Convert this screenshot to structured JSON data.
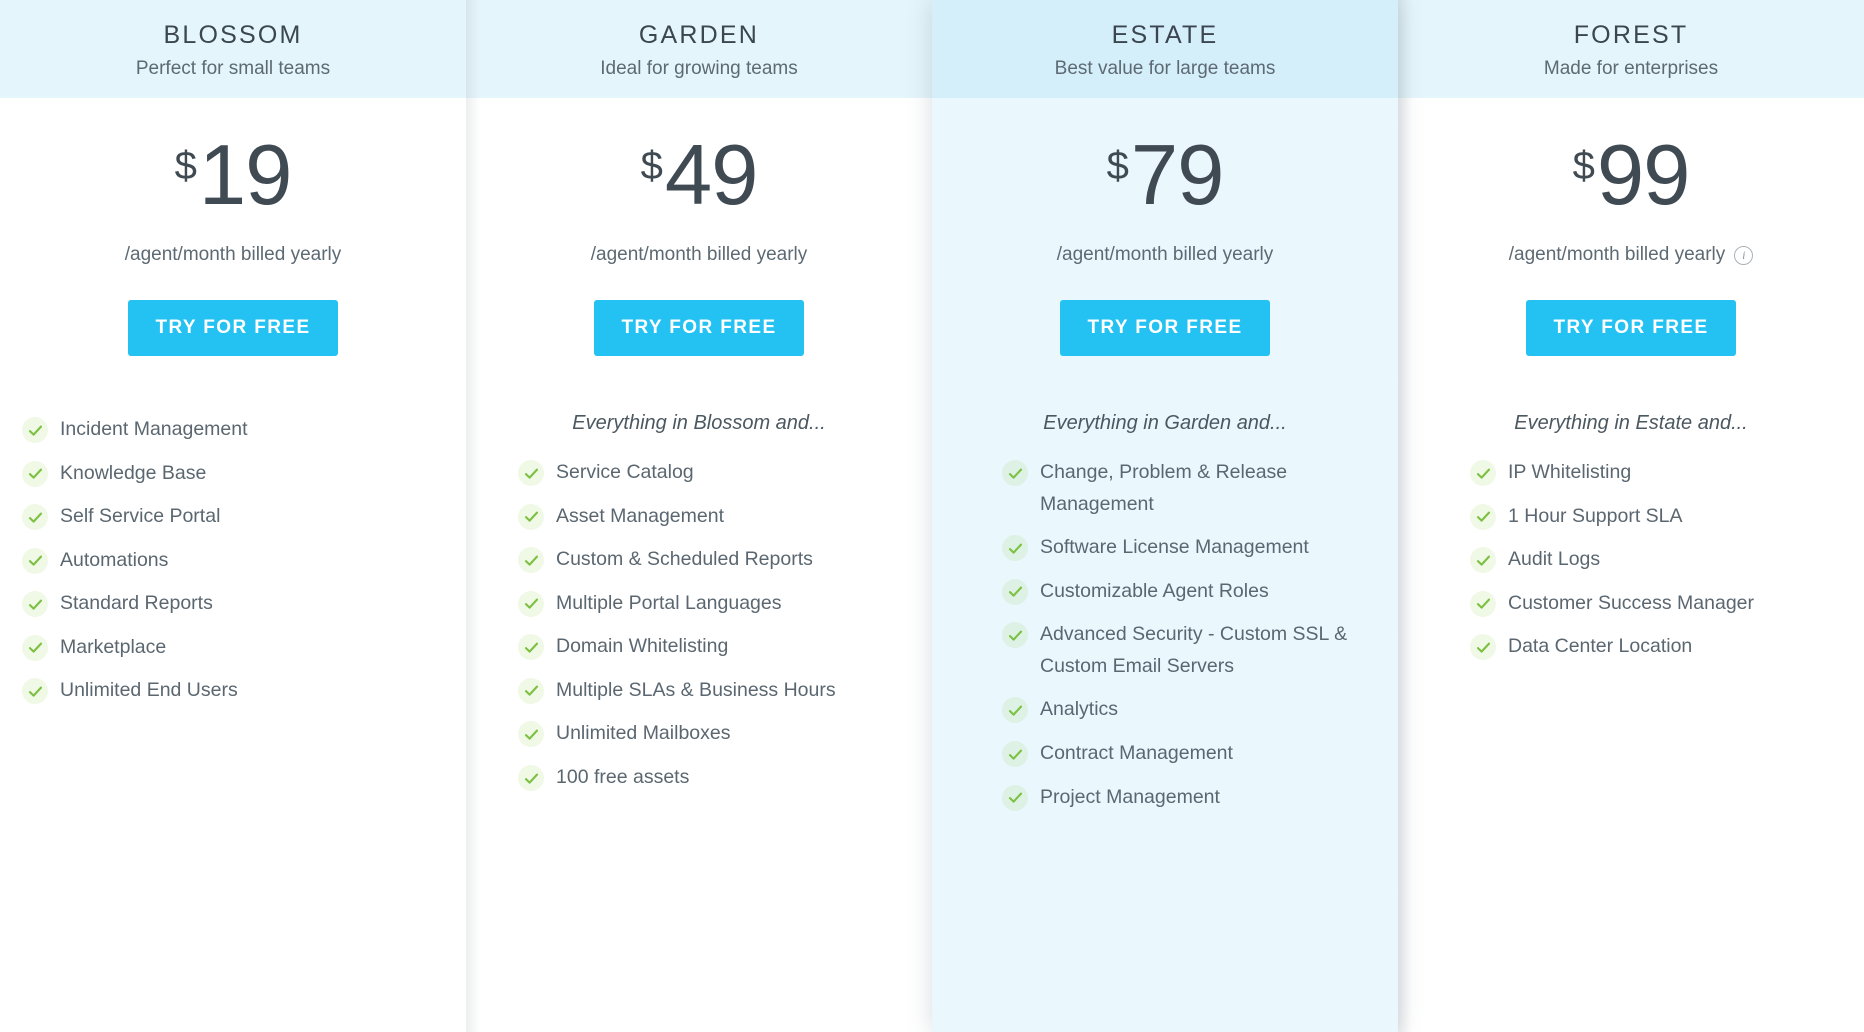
{
  "theme": {
    "cta_color": "#24c2f2",
    "header_bg": "#e4f5fb",
    "featured_header_bg": "#d4effa",
    "featured_card_bg": "#eaf7fd",
    "check_color": "#7cc142",
    "text_color": "#5b6770"
  },
  "plans": [
    {
      "name": "BLOSSOM",
      "tagline": "Perfect for small teams",
      "currency": "$",
      "price": "19",
      "price_note": "/agent/month billed yearly",
      "has_info_icon": false,
      "cta_label": "TRY FOR FREE",
      "inherits_note": "",
      "features": [
        "Incident Management",
        "Knowledge Base",
        "Self Service Portal",
        "Automations",
        "Standard Reports",
        "Marketplace",
        "Unlimited End Users"
      ]
    },
    {
      "name": "GARDEN",
      "tagline": "Ideal for growing teams",
      "currency": "$",
      "price": "49",
      "price_note": "/agent/month billed yearly",
      "has_info_icon": false,
      "cta_label": "TRY FOR FREE",
      "inherits_note": "Everything in Blossom and...",
      "features": [
        "Service Catalog",
        "Asset Management",
        "Custom & Scheduled Reports",
        "Multiple Portal Languages",
        "Domain Whitelisting",
        "Multiple SLAs & Business Hours",
        "Unlimited Mailboxes",
        "100 free assets"
      ]
    },
    {
      "name": "ESTATE",
      "tagline": "Best value for large teams",
      "currency": "$",
      "price": "79",
      "price_note": "/agent/month billed yearly",
      "has_info_icon": false,
      "cta_label": "TRY FOR FREE",
      "inherits_note": "Everything in Garden and...",
      "features": [
        "Change, Problem & Release Management",
        "Software License Management",
        "Customizable Agent Roles",
        "Advanced Security - Custom SSL & Custom Email Servers",
        "Analytics",
        "Contract Management",
        "Project Management"
      ]
    },
    {
      "name": "FOREST",
      "tagline": "Made for enterprises",
      "currency": "$",
      "price": "99",
      "price_note": "/agent/month billed yearly",
      "has_info_icon": true,
      "info_icon_glyph": "i",
      "cta_label": "TRY FOR FREE",
      "inherits_note": "Everything in Estate and...",
      "features": [
        "IP Whitelisting",
        "1 Hour Support SLA",
        "Audit Logs",
        "Customer Success Manager",
        "Data Center Location"
      ]
    }
  ]
}
